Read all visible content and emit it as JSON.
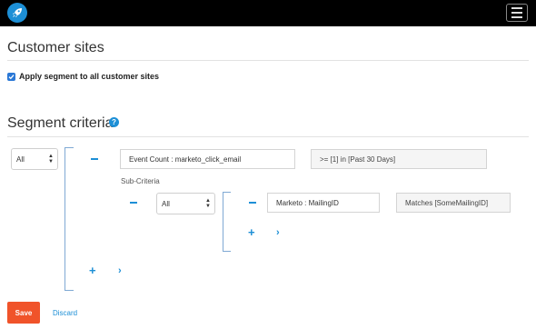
{
  "header": {
    "logo_icon": "rocket-icon",
    "menu_icon": "hamburger-icon"
  },
  "customer_sites": {
    "title": "Customer sites",
    "apply_checkbox_label": "Apply segment to all customer sites",
    "apply_checked": true
  },
  "segment_criteria": {
    "title": "Segment criteria",
    "help_label": "?",
    "top_operator": "All",
    "criterion": {
      "field": "Event Count : marketo_click_email",
      "condition": ">= [1] in [Past 30 Days]"
    },
    "sub_criteria_label": "Sub-Criteria",
    "sub_operator": "All",
    "sub_criterion": {
      "field": "Marketo : MailingID",
      "condition": "Matches [SomeMailingID]"
    }
  },
  "actions": {
    "save_label": "Save",
    "discard_label": "Discard"
  },
  "colors": {
    "accent": "#1d8fd6",
    "save": "#f0532a",
    "bracket": "#7fa9d4"
  }
}
